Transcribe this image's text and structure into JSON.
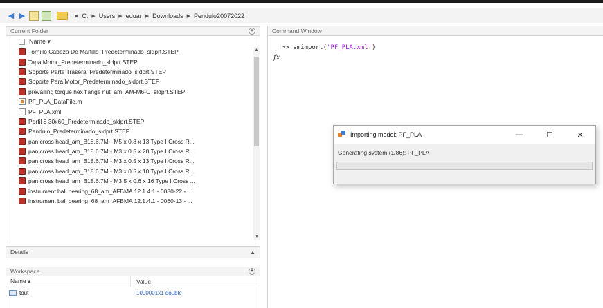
{
  "address_bar": {
    "crumbs": [
      "C:",
      "Users",
      "eduar",
      "Downloads",
      "Pendulo20072022"
    ]
  },
  "current_folder": {
    "title": "Current Folder",
    "column_name": "Name ▾",
    "files": [
      {
        "name": "Tornillo Cabeza De Martillo_Predeterminado_sldprt.STEP",
        "type": "step"
      },
      {
        "name": "Tapa Motor_Predeterminado_sldprt.STEP",
        "type": "step"
      },
      {
        "name": "Soporte Parte Trasera_Predeterminado_sldprt.STEP",
        "type": "step"
      },
      {
        "name": "Soporte Para Motor_Predeterminado_sldprt.STEP",
        "type": "step"
      },
      {
        "name": "prevailing torque hex flange nut_am_AM-M6-C_sldprt.STEP",
        "type": "step"
      },
      {
        "name": "PF_PLA_DataFile.m",
        "type": "m"
      },
      {
        "name": "PF_PLA.xml",
        "type": "xml"
      },
      {
        "name": "Perfil 8 30x60_Predeterminado_sldprt.STEP",
        "type": "step"
      },
      {
        "name": "Pendulo_Predeterminado_sldprt.STEP",
        "type": "step"
      },
      {
        "name": "pan cross head_am_B18.6.7M - M5 x 0.8 x 13 Type I Cross R...",
        "type": "step"
      },
      {
        "name": "pan cross head_am_B18.6.7M - M3 x 0.5 x 20 Type I Cross R...",
        "type": "step"
      },
      {
        "name": "pan cross head_am_B18.6.7M - M3 x 0.5 x 13 Type I Cross R...",
        "type": "step"
      },
      {
        "name": "pan cross head_am_B18.6.7M - M3 x 0.5 x 10 Type I Cross R...",
        "type": "step"
      },
      {
        "name": "pan cross head_am_B18.6.7M - M3.5 x 0.6 x 16 Type I Cross ...",
        "type": "step"
      },
      {
        "name": "instrument ball bearing_68_am_AFBMA 12.1.4.1 - 0080-22 - ...",
        "type": "step"
      },
      {
        "name": "instrument ball bearing_68_am_AFBMA 12.1.4.1 - 0060-13 - ...",
        "type": "step"
      }
    ]
  },
  "details": {
    "title": "Details"
  },
  "workspace": {
    "title": "Workspace",
    "col_name": "Name ▴",
    "col_value": "Value",
    "rows": [
      {
        "name": "tout",
        "value": "1000001x1 double"
      }
    ]
  },
  "command_window": {
    "title": "Command Window",
    "prompt": ">> ",
    "cmd_prefix": "smimport(",
    "cmd_string": "'PF_PLA.xml'",
    "cmd_suffix": ")",
    "fx_label": "fx"
  },
  "dialog": {
    "title": "Importing model: PF_PLA",
    "status": "Generating system (1/86): PF_PLA",
    "minimize": "—",
    "maximize": "☐",
    "close": "✕",
    "progress": 0
  }
}
